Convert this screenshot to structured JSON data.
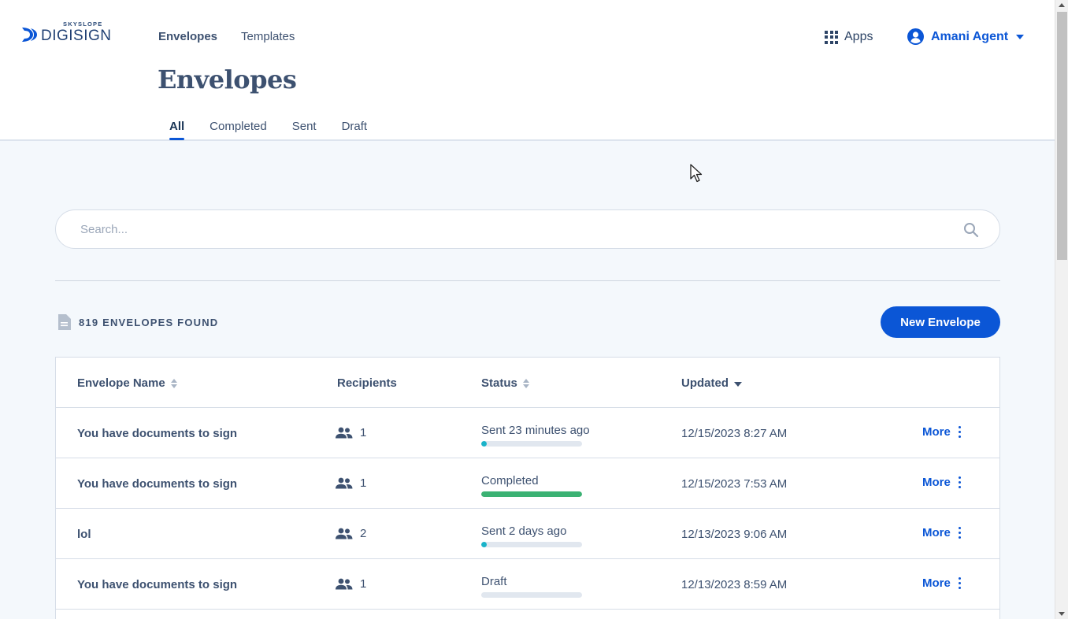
{
  "brand": {
    "small": "SKYSLOPE",
    "big": "DIGISIGN"
  },
  "nav": {
    "envelopes": "Envelopes",
    "templates": "Templates"
  },
  "apps_label": "Apps",
  "user_name": "Amani Agent",
  "page_title": "Envelopes",
  "tabs": [
    "All",
    "Completed",
    "Sent",
    "Draft"
  ],
  "search": {
    "placeholder": "Search..."
  },
  "found_label": "819 ENVELOPES FOUND",
  "new_button": "New Envelope",
  "columns": {
    "name": "Envelope Name",
    "recipients": "Recipients",
    "status": "Status",
    "updated": "Updated"
  },
  "rows": [
    {
      "name": "You have documents to sign",
      "recipients": "1",
      "status": "Sent 23 minutes ago",
      "progress": 0.05,
      "color": "#1ab3c9",
      "updated": "12/15/2023 8:27 AM",
      "more": "More"
    },
    {
      "name": "You have documents to sign",
      "recipients": "1",
      "status": "Completed",
      "progress": 1.0,
      "color": "#3bb273",
      "updated": "12/15/2023 7:53 AM",
      "more": "More"
    },
    {
      "name": "lol",
      "recipients": "2",
      "status": "Sent 2 days ago",
      "progress": 0.05,
      "color": "#1ab3c9",
      "updated": "12/13/2023 9:06 AM",
      "more": "More"
    },
    {
      "name": "You have documents to sign",
      "recipients": "1",
      "status": "Draft",
      "progress": 0,
      "color": "#1ab3c9",
      "updated": "12/13/2023 8:59 AM",
      "more": "More"
    }
  ],
  "colors": {
    "accent": "#0b56d6",
    "text": "#3d5170",
    "completed": "#3bb273",
    "sent": "#1ab3c9"
  }
}
